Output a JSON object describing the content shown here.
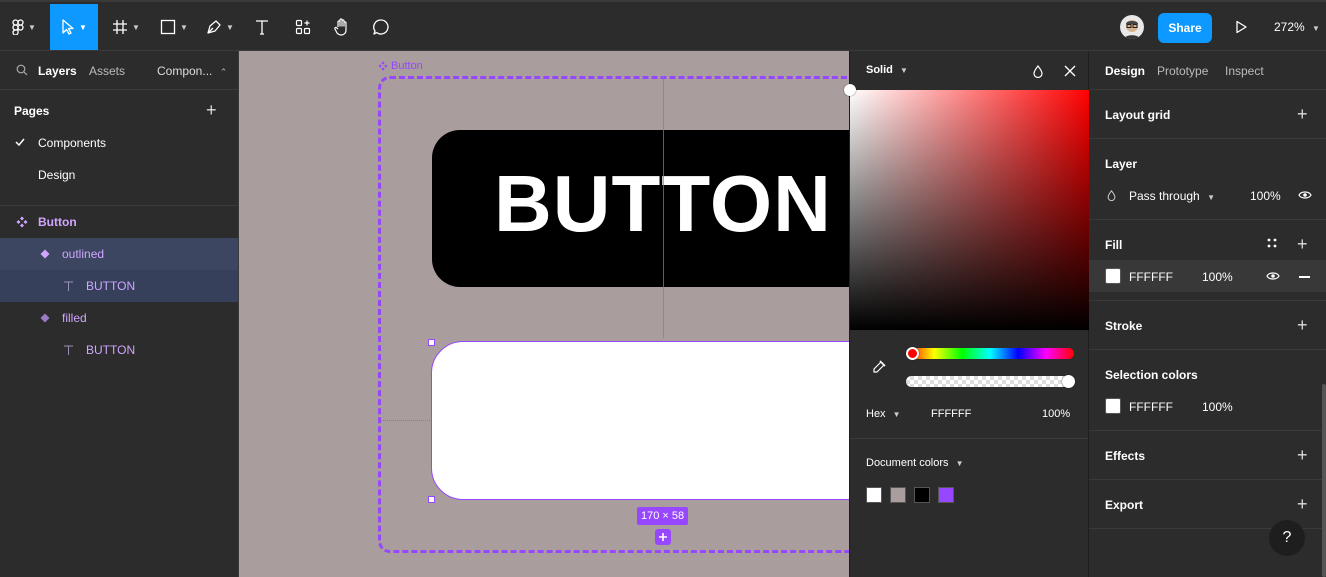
{
  "toolbar": {
    "share_label": "Share",
    "zoom_label": "272%"
  },
  "left_panel": {
    "tabs": [
      "Layers",
      "Assets",
      "Compon..."
    ],
    "pages_title": "Pages",
    "pages": [
      "Components",
      "Design"
    ],
    "layers": [
      {
        "label": "Button",
        "kind": "component"
      },
      {
        "label": "outlined",
        "kind": "variant"
      },
      {
        "label": "BUTTON",
        "kind": "text"
      },
      {
        "label": "filled",
        "kind": "variant"
      },
      {
        "label": "BUTTON",
        "kind": "text"
      }
    ]
  },
  "canvas": {
    "frame_label": "Button",
    "button_text": "BUTTON",
    "size_badge": "170 × 58"
  },
  "color_picker": {
    "mode_label": "Solid",
    "format_label": "Hex",
    "hex_value": "FFFFFF",
    "opacity": "100%",
    "document_colors_label": "Document colors",
    "document_colors": [
      "#ffffff",
      "#a99d9d",
      "#000000",
      "#9747ff"
    ]
  },
  "right_panel": {
    "tabs": [
      "Design",
      "Prototype",
      "Inspect"
    ],
    "layout_grid": "Layout grid",
    "layer_title": "Layer",
    "blend_mode": "Pass through",
    "layer_opacity": "100%",
    "fill_title": "Fill",
    "fill_hex": "FFFFFF",
    "fill_opacity": "100%",
    "stroke_title": "Stroke",
    "selection_colors_title": "Selection colors",
    "selection_hex": "FFFFFF",
    "selection_opacity": "100%",
    "effects_title": "Effects",
    "export_title": "Export",
    "help_label": "?"
  },
  "colors": {
    "accent": "#0d99ff",
    "component_purple": "#9747ff",
    "canvas_bg": "#a99d9d"
  }
}
